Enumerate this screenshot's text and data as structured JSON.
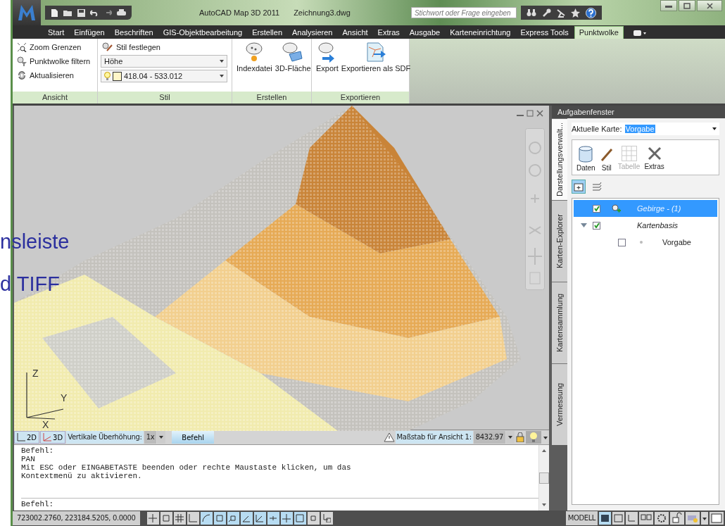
{
  "slide_texts": [
    "nsleiste",
    "d TIFF"
  ],
  "window": {
    "app_title": "AutoCAD Map 3D 2011",
    "document_title": "Zeichnung3.dwg",
    "search_placeholder": "Stichwort oder Frage eingeben"
  },
  "tabs": [
    {
      "label": "Start",
      "selected": false
    },
    {
      "label": "Einfügen",
      "selected": false
    },
    {
      "label": "Beschriften",
      "selected": false
    },
    {
      "label": "GIS-Objektbearbeitung",
      "selected": false
    },
    {
      "label": "Erstellen",
      "selected": false
    },
    {
      "label": "Analysieren",
      "selected": false
    },
    {
      "label": "Ansicht",
      "selected": false
    },
    {
      "label": "Extras",
      "selected": false
    },
    {
      "label": "Ausgabe",
      "selected": false
    },
    {
      "label": "Karteneinrichtung",
      "selected": false
    },
    {
      "label": "Express Tools",
      "selected": false
    },
    {
      "label": "Punktwolke",
      "selected": true
    }
  ],
  "ribbon": {
    "ansicht": {
      "title": "Ansicht",
      "items": [
        "Zoom Grenzen",
        "Punktwolke filtern",
        "Aktualisieren"
      ]
    },
    "stil": {
      "title": "Stil",
      "button": "Stil festlegen",
      "dropdown": "Höhe",
      "range": "418.04 - 533.012"
    },
    "erstellen": {
      "title": "Erstellen",
      "buttons": [
        "Indexdatei",
        "3D-Fläche"
      ]
    },
    "exportieren": {
      "title": "Exportieren",
      "buttons": [
        "Export",
        "Exportieren als SDF"
      ]
    }
  },
  "viewport": {
    "axis_labels": [
      "Z",
      "Y",
      "X"
    ]
  },
  "viewport_bar": {
    "mode_2d": "2D",
    "mode_3d": "3D",
    "exaggeration_label": "Vertikale Überhöhung:",
    "exaggeration_value": "1x",
    "command_tab": "Befehl",
    "scale_label": "Maßstab für Ansicht 1:",
    "scale_value": "8432.97"
  },
  "command": {
    "lines": [
      "Befehl:",
      "PAN",
      "Mit ESC oder EINGABETASTE beenden oder rechte Maustaste klicken, um das",
      "Kontextmenü zu aktivieren."
    ],
    "prompt": "Befehl:"
  },
  "status_bar": {
    "coordinates": "723002.2760, 223184.5205, 0.0000",
    "toggles": [
      {
        "on": false
      },
      {
        "on": false
      },
      {
        "on": false
      },
      {
        "on": false
      },
      {
        "on": true
      },
      {
        "on": true
      },
      {
        "on": true
      },
      {
        "on": true
      },
      {
        "on": true
      },
      {
        "on": true
      },
      {
        "on": true
      },
      {
        "on": true
      },
      {
        "on": false
      },
      {
        "on": false
      }
    ],
    "space": "MODELL"
  },
  "task_pane": {
    "title": "Aufgabenfenster",
    "map_label": "Aktuelle Karte:",
    "map_value": "Vorgabe",
    "tools": [
      {
        "label": "Daten",
        "disabled": false
      },
      {
        "label": "Stil",
        "disabled": false
      },
      {
        "label": "Tabelle",
        "disabled": true
      },
      {
        "label": "Extras",
        "disabled": false
      }
    ],
    "side_tabs": [
      {
        "label": "Darstellungsverwalt...",
        "selected": true
      },
      {
        "label": "Karten-Explorer",
        "selected": false
      },
      {
        "label": "Kartensammlung",
        "selected": false
      },
      {
        "label": "Vermessung",
        "selected": false
      }
    ],
    "layers": [
      {
        "label": "Gebirge - (1)",
        "kind": "layer",
        "checked": true,
        "selected": true
      },
      {
        "label": "Kartenbasis",
        "kind": "group",
        "checked": true,
        "selected": false,
        "expanded": true,
        "children": [
          {
            "label": "Vorgabe",
            "kind": "style",
            "checked": false,
            "selected": false
          }
        ]
      }
    ]
  }
}
